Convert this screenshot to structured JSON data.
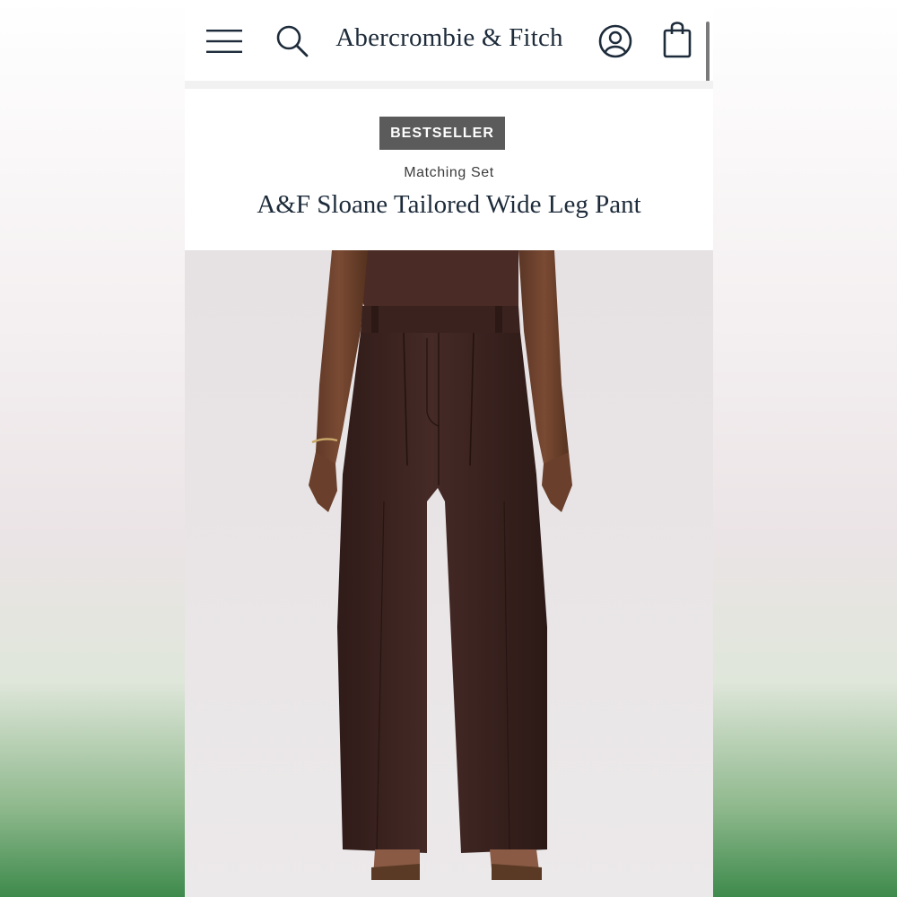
{
  "header": {
    "logo": "Abercrombie & Fitch",
    "icons": [
      "menu-icon",
      "search-icon",
      "account-icon",
      "shopping-bag-icon"
    ]
  },
  "product": {
    "badge": "BESTSELLER",
    "collection": "Matching Set",
    "title": "A&F Sloane Tailored Wide Leg Pant",
    "image_alt": "Model wearing brown tailored wide leg pants with a brown top"
  },
  "colors": {
    "brand_navy": "#1d2b3a",
    "badge_bg": "#5b5b5b",
    "pant_brown": "#3b2320",
    "backdrop": "#e9e5e7"
  }
}
